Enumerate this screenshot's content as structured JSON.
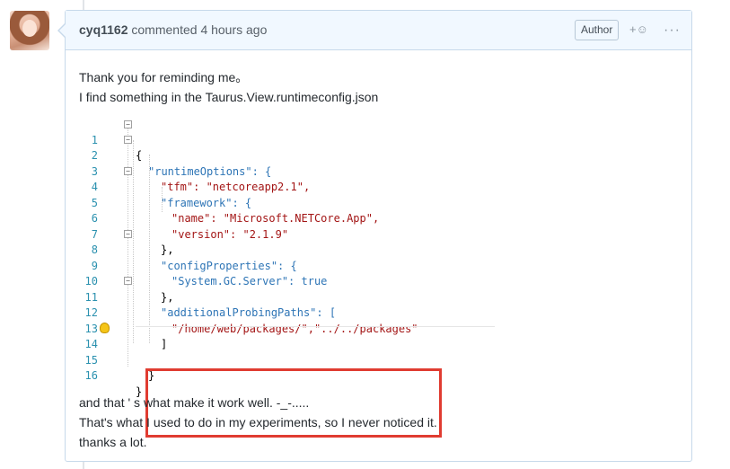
{
  "comment": {
    "author": "cyq1162",
    "action": "commented",
    "time": "4 hours ago",
    "badge": "Author",
    "reaction_icon": "smiley-add-icon",
    "more_icon": "ellipsis-icon",
    "intro": [
      "Thank you for reminding me。",
      "I find something in the Taurus.View.runtimeconfig.json"
    ],
    "outro": [
      "and that ' s what make it work well. -_-.....",
      "That's what I used to do in my experiments, so I never noticed it.",
      "thanks a lot."
    ]
  },
  "code": {
    "line_numbers": [
      "1",
      "2",
      "3",
      "4",
      "5",
      "6",
      "7",
      "8",
      "9",
      "10",
      "11",
      "12",
      "13",
      "14",
      "15",
      "16"
    ],
    "lines": [
      "{",
      "\"runtimeOptions\": {",
      "\"tfm\": \"netcoreapp2.1\",",
      "\"framework\": {",
      "\"name\": \"Microsoft.NETCore.App\",",
      "\"version\": \"2.1.9\"",
      "},",
      "\"configProperties\": {",
      "\"System.GC.Server\": true",
      "},",
      "\"additionalProbingPaths\": [",
      "\"/home/web/packages/\",\"../../packages\"",
      "]",
      "",
      "}",
      "}"
    ]
  },
  "colors": {
    "highlight_box": "#e03c31",
    "header_bg": "#f1f8ff",
    "border": "#c7d9ea",
    "line_number": "#2b91af",
    "json_key": "#2e75b6",
    "json_string": "#a31515"
  }
}
